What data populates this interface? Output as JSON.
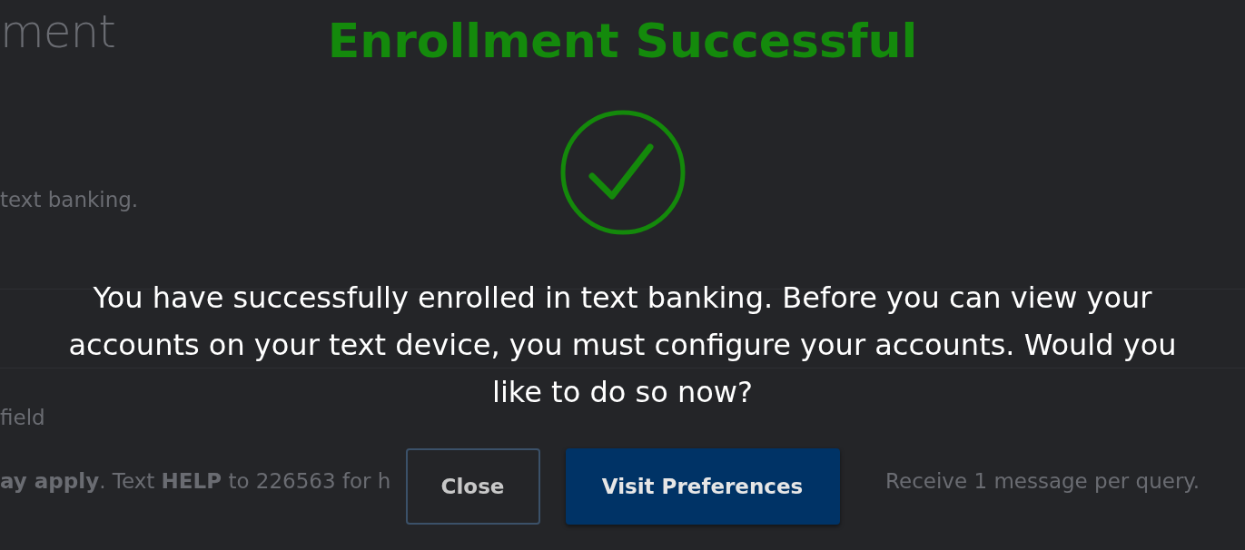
{
  "page": {
    "heading": "ment",
    "lines": [
      {
        "kind": "text",
        "text": "text banking."
      },
      {
        "kind": "rule"
      },
      {
        "kind": "rule"
      },
      {
        "kind": "text",
        "text": "field"
      },
      {
        "kind": "disclaimer",
        "text": "**ay apply**. Text **HELP** to 226563 for h",
        "tail": "Receive 1 message per query."
      }
    ]
  },
  "dialog": {
    "title": "Enrollment Successful",
    "message": "You have successfully enrolled in text banking. Before you can view your accounts on your text device, you must configure your accounts. Would you like to do so now?",
    "buttons": [
      {
        "label": "Close",
        "kind": "secondary"
      },
      {
        "label": "Visit Preferences",
        "kind": "primary"
      }
    ]
  }
}
